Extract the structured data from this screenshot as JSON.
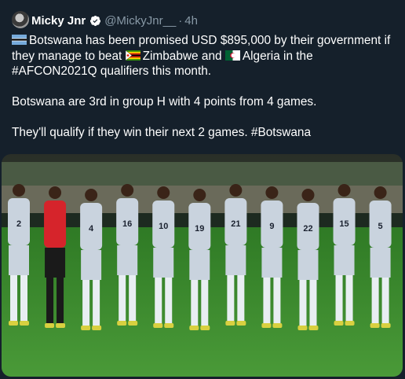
{
  "tweet": {
    "author_name": "Micky Jnr",
    "author_handle": "@MickyJnr__",
    "separator": "·",
    "time": "4h",
    "line1_a": "Botswana has been promised USD $895,000 by their government if",
    "line2_a": "they manage to beat ",
    "line2_b": "Zimbabwe and ",
    "line2_c": "Algeria in the",
    "line3": "#AFCON2021Q qualifiers this month.",
    "para2": "Botswana are 3rd in group H with 4 points from 4 games.",
    "para3": "They'll qualify if they win their next 2 games. #Botswana"
  },
  "icons": {
    "avatar": "avatar-icon",
    "verified": "verified-badge-icon",
    "flag1": "botswana-flag-icon",
    "flag2": "zimbabwe-flag-icon",
    "flag3": "algeria-flag-icon"
  },
  "colors": {
    "background": "#15202b",
    "secondary_text": "#8899a6",
    "text": "#ffffff",
    "jersey": "#c9d3de",
    "goalkeeper": "#d6242b",
    "pitch": "#3b8a2e"
  },
  "photo": {
    "alt": "Botswana national football team line-up",
    "jersey_numbers": [
      "2",
      "4",
      "16",
      "10",
      "19",
      "21",
      "9",
      "22",
      "15",
      "5"
    ]
  }
}
